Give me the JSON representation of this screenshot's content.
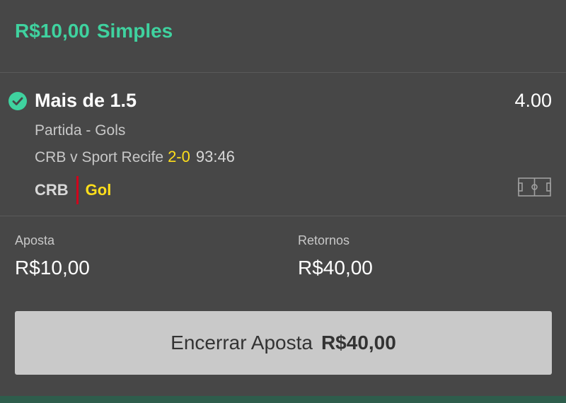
{
  "header": {
    "stake": "R$10,00",
    "bet_type": "Simples"
  },
  "selection": {
    "status_icon": "check-circle-icon",
    "name": "Mais de 1.5",
    "odds": "4.00",
    "market": "Partida - Gols",
    "event": "CRB v Sport Recife",
    "score": "2-0",
    "clock": "93:46",
    "last_incident_team": "CRB",
    "last_incident_type": "Gol",
    "pitch_icon": "football-pitch-icon"
  },
  "stake": {
    "label": "Aposta",
    "value": "R$10,00"
  },
  "returns": {
    "label": "Retornos",
    "value": "R$40,00"
  },
  "cashout": {
    "label": "Encerrar Aposta",
    "amount": "R$40,00"
  },
  "colors": {
    "accent": "#3fd29f",
    "highlight": "#ffdf1b",
    "incident_bar": "#d0021b",
    "background": "#474747"
  }
}
